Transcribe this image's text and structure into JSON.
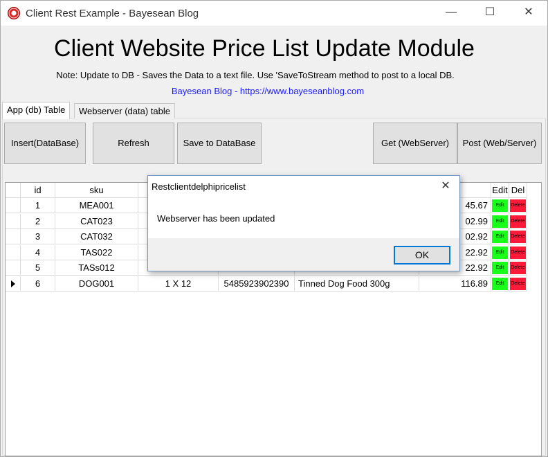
{
  "window": {
    "title": "Client Rest Example - Bayesean Blog",
    "minimize_glyph": "—",
    "maximize_glyph": "☐",
    "close_glyph": "✕"
  },
  "header": {
    "heading": "Client Website Price List Update Module",
    "note": "Note: Update to DB -  Saves the Data to a text file. Use 'SaveToStream method to post to a local DB.",
    "blog_link": "Bayesean Blog - https://www.bayeseanblog.com"
  },
  "tabs": [
    {
      "label": "App (db) Table",
      "active": true
    },
    {
      "label": "Webserver (data) table",
      "active": false
    }
  ],
  "toolbar": {
    "insert_label": "Insert(DataBase)",
    "refresh_label": "Refresh",
    "save_label": "Save to DataBase",
    "get_label": "Get  (WebServer)",
    "post_label": "Post (Web/Server)"
  },
  "grid": {
    "columns": {
      "id": "id",
      "sku": "sku",
      "edit": "Edit",
      "del": "Del"
    },
    "edit_chip": "Edit",
    "delete_chip": "Delete",
    "rows": [
      {
        "id": "1",
        "sku": "MEA001",
        "pack": "",
        "barcode": "",
        "desc": "",
        "price": "45.67"
      },
      {
        "id": "2",
        "sku": "CAT023",
        "pack": "",
        "barcode": "",
        "desc": "",
        "price": "02.99"
      },
      {
        "id": "3",
        "sku": "CAT032",
        "pack": "",
        "barcode": "",
        "desc": "",
        "price": "02.92"
      },
      {
        "id": "4",
        "sku": "TAS022",
        "pack": "",
        "barcode": "",
        "desc": "",
        "price": "22.92"
      },
      {
        "id": "5",
        "sku": "TASs012",
        "pack": "",
        "barcode": "",
        "desc": "",
        "price": "22.92"
      },
      {
        "id": "6",
        "sku": "DOG001",
        "pack": "1 X 12",
        "barcode": "5485923902390",
        "desc": "Tinned Dog Food 300g",
        "price": "116.89"
      }
    ]
  },
  "dialog": {
    "title": "Restclientdelphipricelist",
    "message": "Webserver has been updated",
    "ok_label": "OK",
    "close_glyph": "✕"
  },
  "colors": {
    "link": "#1a1aff",
    "edit_chip": "#19ff19",
    "delete_chip": "#ff1a3a",
    "focus_border": "#0078d7"
  }
}
